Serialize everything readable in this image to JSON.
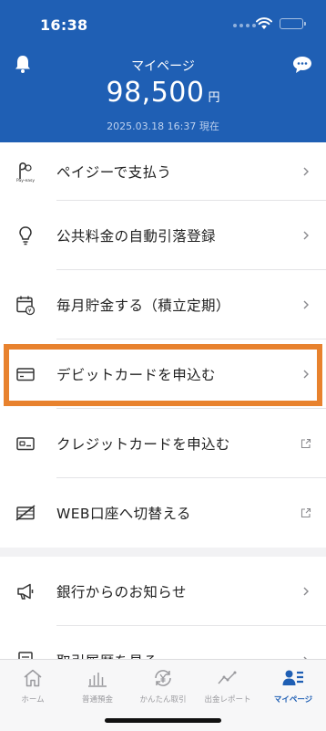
{
  "status_bar": {
    "time": "16:38"
  },
  "header": {
    "title": "マイページ",
    "balance_amount": "98,500",
    "balance_unit": "円",
    "timestamp": "2025.03.18 16:37 現在",
    "accent_color": "#1f5fb4"
  },
  "menu": {
    "items": [
      {
        "label": "ペイジーで支払う",
        "icon": "pay-easy-icon",
        "trail": "chevron-right"
      },
      {
        "label": "公共料金の自動引落登録",
        "icon": "lightbulb-icon",
        "trail": "chevron-right"
      },
      {
        "label": "毎月貯金する（積立定期）",
        "icon": "calendar-yen-icon",
        "trail": "chevron-right"
      },
      {
        "label": "デビットカードを申込む",
        "icon": "card-icon",
        "trail": "chevron-right"
      },
      {
        "label": "クレジットカードを申込む",
        "icon": "credit-card-icon",
        "trail": "external-link"
      },
      {
        "label": "WEB口座へ切替える",
        "icon": "no-passbook-icon",
        "trail": "external-link"
      },
      {
        "label": "銀行からのお知らせ",
        "icon": "megaphone-icon",
        "trail": "chevron-right"
      },
      {
        "label": "取引履歴を見る",
        "icon": "document-icon",
        "trail": "chevron-right"
      }
    ],
    "highlight_color": "#e8822e"
  },
  "tabbar": {
    "tabs": [
      {
        "label": "ホーム",
        "icon": "home-icon"
      },
      {
        "label": "普通預金",
        "icon": "bar-chart-icon"
      },
      {
        "label": "かんたん取引",
        "icon": "yen-exchange-icon"
      },
      {
        "label": "出金レポート",
        "icon": "line-chart-icon"
      },
      {
        "label": "マイページ",
        "icon": "user-list-icon",
        "active": true
      }
    ]
  }
}
